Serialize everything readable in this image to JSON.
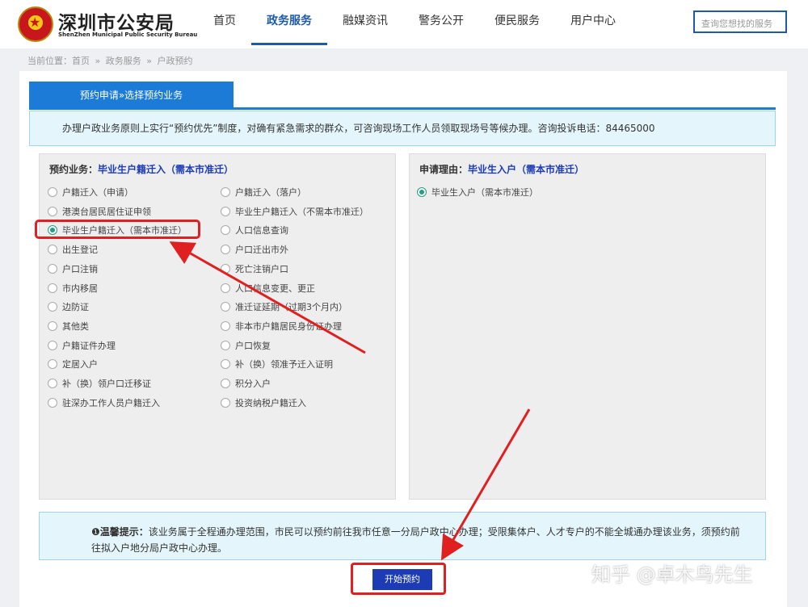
{
  "header": {
    "brand_cn": "深圳市公安局",
    "brand_en": "ShenZhen Municipal Public Security Bureau",
    "nav": [
      "首页",
      "政务服务",
      "融媒资讯",
      "警务公开",
      "便民服务",
      "用户中心"
    ],
    "active_nav": "政务服务",
    "search_placeholder": "查询您想找的服务"
  },
  "breadcrumb": [
    "当前位置：首页",
    "»",
    "政务服务",
    "»",
    "户政预约"
  ],
  "tab_label": "预约申请»选择预约业务",
  "notice": "办理户政业务原则上实行“预约优先”制度，对确有紧急需求的群众，可咨询现场工作人员领取现场号等候办理。咨询投诉电话：84465000",
  "left_box": {
    "title_label": "预约业务：",
    "title_value": "毕业生户籍迁入（需本市准迁）",
    "col1": [
      "户籍迁入（申请）",
      "港澳台居民居住证申领",
      "毕业生户籍迁入（需本市准迁）",
      "出生登记",
      "户口注销",
      "市内移居",
      "边防证",
      "其他类",
      "户籍证件办理",
      "定居入户",
      "补（换）领户口迁移证",
      "驻深办工作人员户籍迁入"
    ],
    "col2": [
      "户籍迁入（落户）",
      "毕业生户籍迁入（不需本市准迁）",
      "人口信息查询",
      "户口迁出市外",
      "死亡注销户口",
      "人口信息变更、更正",
      "准迁证延期（过期3个月内）",
      "非本市户籍居民身份证办理",
      "户口恢复",
      "补（换）领准予迁入证明",
      "积分入户",
      "投资纳税户籍迁入"
    ],
    "selected": "毕业生户籍迁入（需本市准迁）"
  },
  "right_box": {
    "title_label": "申请理由：",
    "title_value": "毕业生入户（需本市准迁）",
    "options": [
      "毕业生入户（需本市准迁）"
    ],
    "selected": "毕业生入户（需本市准迁）"
  },
  "tip": {
    "label": "温馨提示：",
    "text": "该业务属于全程通办理范围，市民可以预约前往我市任意一分局户政中心办理；受限集体户、人才专户的不能全城通办理该业务，须预约前往拟入户地分局户政中心办理。"
  },
  "start_button": "开始预约",
  "watermark": "知乎 @卓木鸟先生",
  "colors": {
    "primary_blue": "#1b7bd6",
    "dark_blue": "#1c3bb5",
    "highlight_red": "#e02020",
    "radio_green": "#20a080"
  }
}
